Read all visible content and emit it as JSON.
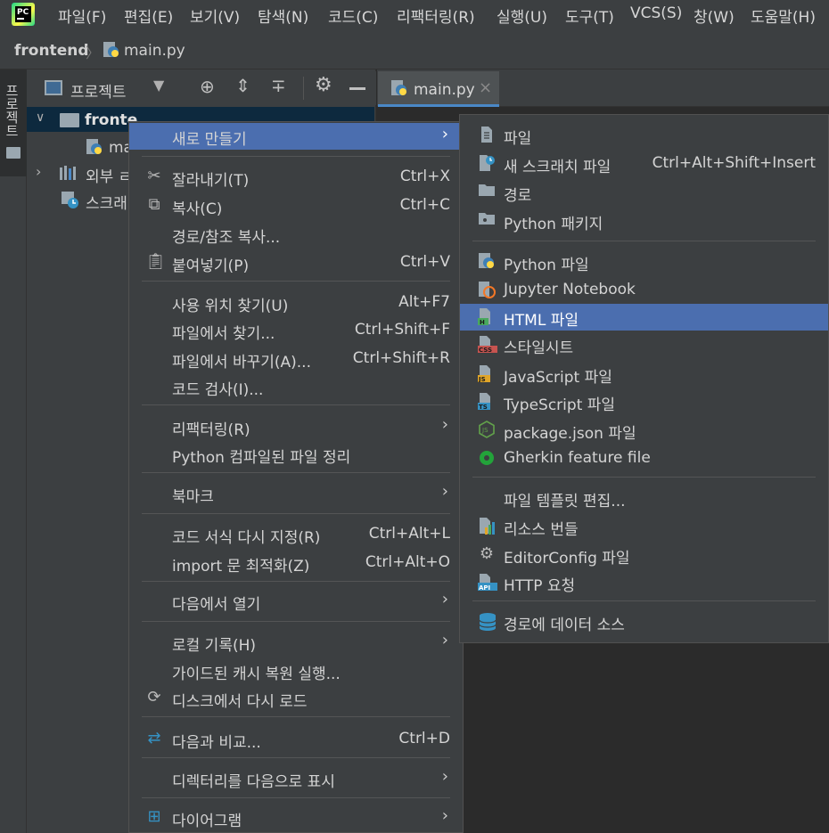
{
  "menubar": {
    "items": [
      "파일(F)",
      "편집(E)",
      "보기(V)",
      "탐색(N)",
      "코드(C)",
      "리팩터링(R)",
      "실행(U)",
      "도구(T)",
      "VCS(S)",
      "창(W)",
      "도움말(H)"
    ]
  },
  "breadcrumb": {
    "project": "frontend",
    "file": "main.py"
  },
  "sidebar": {
    "tab_label": "프로젝트"
  },
  "project_panel": {
    "title": "프로젝트",
    "tree": {
      "root": "fronte",
      "child": "ma",
      "external": "외부 ㄹ",
      "scratch": "스크래"
    }
  },
  "editor": {
    "tab_label": "main.py",
    "close_glyph": "×"
  },
  "context_menu": {
    "new": "새로 만들기",
    "cut": "잘라내기(T)",
    "cut_sc": "Ctrl+X",
    "copy": "복사(C)",
    "copy_sc": "Ctrl+C",
    "copy_path": "경로/참조 복사...",
    "paste": "붙여넣기(P)",
    "paste_sc": "Ctrl+V",
    "find_usages": "사용 위치 찾기(U)",
    "find_usages_sc": "Alt+F7",
    "find_in_files": "파일에서 찾기...",
    "find_in_files_sc": "Ctrl+Shift+F",
    "replace_in_files": "파일에서 바꾸기(A)...",
    "replace_in_files_sc": "Ctrl+Shift+R",
    "inspect_code": "코드 검사(I)...",
    "refactor": "리팩터링(R)",
    "clean_py": "Python 컴파일된 파일 정리",
    "bookmark": "북마크",
    "reformat": "코드 서식 다시 지정(R)",
    "reformat_sc": "Ctrl+Alt+L",
    "optimize_imports": "import 문 최적화(Z)",
    "optimize_imports_sc": "Ctrl+Alt+O",
    "open_in": "다음에서 열기",
    "local_history": "로컬 기록(H)",
    "cache_recovery": "가이드된 캐시 복원 실행...",
    "reload": "디스크에서 다시 로드",
    "compare": "다음과 비교...",
    "compare_sc": "Ctrl+D",
    "mark_dir": "디렉터리를 다음으로 표시",
    "diagrams": "다이어그램"
  },
  "submenu": {
    "file": "파일",
    "scratch": "새 스크래치 파일",
    "scratch_sc": "Ctrl+Alt+Shift+Insert",
    "directory": "경로",
    "py_package": "Python 패키지",
    "py_file": "Python 파일",
    "jupyter": "Jupyter Notebook",
    "html": "HTML 파일",
    "stylesheet": "스타일시트",
    "js": "JavaScript 파일",
    "ts": "TypeScript 파일",
    "package_json": "package.json 파일",
    "gherkin": "Gherkin feature file",
    "edit_templates": "파일 템플릿 편집...",
    "resource_bundle": "리소스 번들",
    "editorconfig": "EditorConfig 파일",
    "http_request": "HTTP 요청",
    "datasource": "경로에 데이터 소스"
  },
  "colors": {
    "selection": "#4b6eaf",
    "menu_bg": "#3c3f41",
    "editor_bg": "#2b2b2b"
  }
}
